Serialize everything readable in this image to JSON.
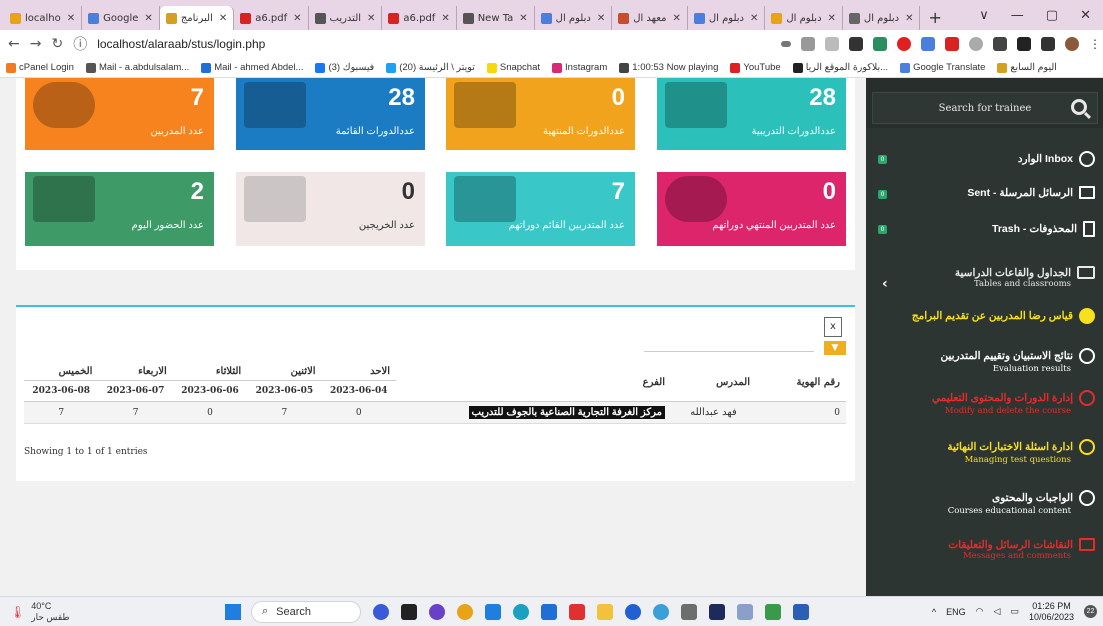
{
  "browser": {
    "tabs": [
      {
        "label": "localho",
        "color": "#e8a317"
      },
      {
        "label": "Google",
        "color": "#4a7fe0"
      },
      {
        "label": "البرنامج",
        "color": "#d5a020",
        "active": true
      },
      {
        "label": "a6.pdf",
        "color": "#d92323"
      },
      {
        "label": "التدريب",
        "color": "#555555"
      },
      {
        "label": "a6.pdf",
        "color": "#d92323"
      },
      {
        "label": "New Ta",
        "color": "#555555"
      },
      {
        "label": "دبلوم ال",
        "color": "#4a7fe0"
      },
      {
        "label": "معهد ال",
        "color": "#c94d2d"
      },
      {
        "label": "دبلوم ال",
        "color": "#4a7fe0"
      },
      {
        "label": "دبلوم ال",
        "color": "#e8a317"
      },
      {
        "label": "دبلوم ال",
        "color": "#666666"
      }
    ],
    "url": "localhost/alaraab/stus/login.php",
    "bookmarks": [
      {
        "label": "cPanel Login",
        "color": "#f07b20"
      },
      {
        "label": "Mail - a.abdulsalam...",
        "color": "#555555"
      },
      {
        "label": "Mail - ahmed Abdel...",
        "color": "#1f6fd6"
      },
      {
        "label": "(3) فيسبوك",
        "color": "#1877f2"
      },
      {
        "label": "(20) تويتر \\ الرئيسة",
        "color": "#1da1f2"
      },
      {
        "label": "Snapchat",
        "color": "#f5d90a"
      },
      {
        "label": "Instagram",
        "color": "#d62976"
      },
      {
        "label": "1:00:53 Now playing",
        "color": "#444444"
      },
      {
        "label": "YouTube",
        "color": "#e02020"
      },
      {
        "label": "بلاكورة الموقع الريا...",
        "color": "#222222"
      },
      {
        "label": "Google Translate",
        "color": "#4a7fe0"
      },
      {
        "label": "اليوم السابع",
        "color": "#d5a020"
      }
    ]
  },
  "stats": [
    {
      "value": "7",
      "label": "عدد المدربين",
      "color": "#f7831f"
    },
    {
      "value": "28",
      "label": "عددالدورات القائمة",
      "color": "#1c7cc3"
    },
    {
      "value": "0",
      "label": "عددالدورات المنتهية",
      "color": "#f2a31d"
    },
    {
      "value": "28",
      "label": "عددالدورات التدريبية",
      "color": "#2bc0ba"
    },
    {
      "value": "2",
      "label": "عدد الحضور اليوم",
      "color": "#3e9a66"
    },
    {
      "value": "0",
      "label": "عدد الخريجين",
      "color": "#f1e7e7"
    },
    {
      "value": "7",
      "label": "عدد المتدربين القائم دوراتهم",
      "color": "#39c7c8"
    },
    {
      "value": "0",
      "label": "عدد المتدربين المنتهي دوراتهم",
      "color": "#dd256c"
    }
  ],
  "table": {
    "headers": {
      "id": "رقم الهوية",
      "trainer": "المدرس",
      "branch": "الفرع"
    },
    "days": [
      {
        "name": "الاحد",
        "date": "2023-06-04"
      },
      {
        "name": "الاثنين",
        "date": "2023-06-05"
      },
      {
        "name": "الثلاثاء",
        "date": "2023-06-06"
      },
      {
        "name": "الاربعاء",
        "date": "2023-06-07"
      },
      {
        "name": "الخميس",
        "date": "2023-06-08"
      }
    ],
    "row": {
      "id": "0",
      "trainer": "فهد عبدالله",
      "branch": "مركز الغرفة التجارية الصناعية بالجوف للتدريب",
      "values": [
        "0",
        "7",
        "0",
        "7",
        "7"
      ]
    },
    "showing": "Showing 1 to 1 of 1 entries"
  },
  "sidebar": {
    "search_placeholder": "Search for trainee",
    "items": [
      {
        "label": "الوارد Inbox",
        "sub": "",
        "color": "#ffffff",
        "badge": "0"
      },
      {
        "label": "Sent - الرسائل المرسلة",
        "sub": "",
        "color": "#ffffff",
        "badge": "0"
      },
      {
        "label": "Trash - المحذوفات",
        "sub": "",
        "color": "#ffffff",
        "badge": "0"
      },
      {
        "label": "الجداول والقاعات الدراسية",
        "sub": "Tables and classrooms",
        "color": "#e8e8e8"
      },
      {
        "label": "قياس رضا المدربين عن تقديم البرامج",
        "sub": "",
        "color": "#f7e01c"
      },
      {
        "label": "نتائج الاستبيان وتقييم المتدربين",
        "sub": "Evaluation results",
        "color": "#ffffff"
      },
      {
        "label": "إدارة الدورات والمحتوى التعليمي",
        "sub": "Modify and delete the course",
        "color": "#e82a2a"
      },
      {
        "label": "ادارة اسئلة الاختبارات النهائية",
        "sub": "Managing test questions",
        "color": "#f7e01c"
      },
      {
        "label": "الواجبات والمحتوى",
        "sub": "Courses educational content",
        "color": "#ffffff"
      },
      {
        "label": "النقاشات الرسائل والتعليقات",
        "sub": "Messages and comments",
        "color": "#e82a2a"
      }
    ]
  },
  "taskbar": {
    "temp": "40°C",
    "weather": "طقس حار",
    "search": "Search",
    "lang": "ENG",
    "time": "01:26 PM",
    "date": "10/06/2023",
    "notif": "22"
  }
}
